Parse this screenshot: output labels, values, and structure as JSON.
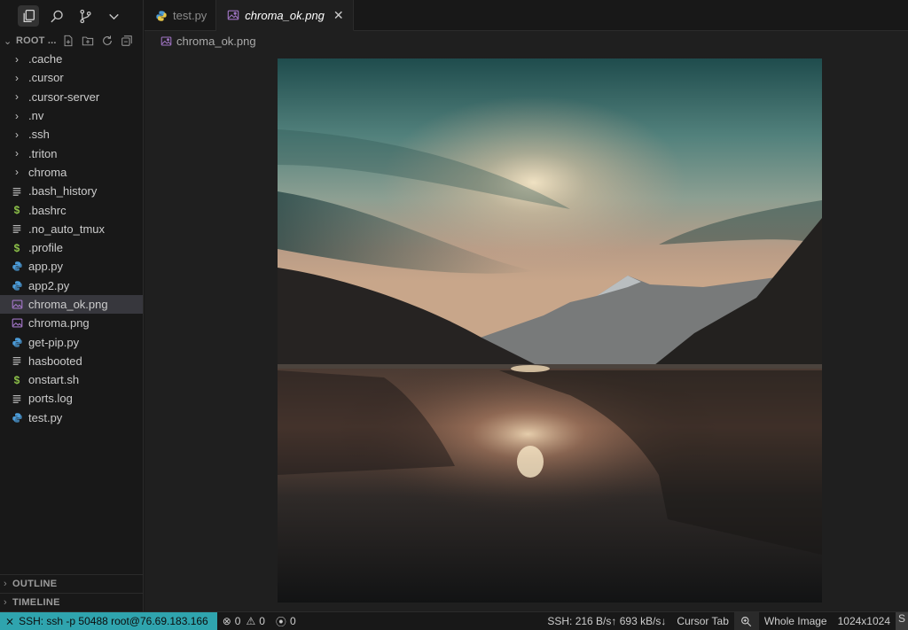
{
  "activity_bar": {
    "items": [
      {
        "name": "explorer-icon",
        "active": true
      },
      {
        "name": "search-icon",
        "active": false
      },
      {
        "name": "source-control-icon",
        "active": false
      },
      {
        "name": "chevron-down-icon",
        "active": false
      }
    ]
  },
  "explorer": {
    "root_label": "ROOT ...",
    "items": [
      {
        "label": ".cache",
        "kind": "folder"
      },
      {
        "label": ".cursor",
        "kind": "folder"
      },
      {
        "label": ".cursor-server",
        "kind": "folder"
      },
      {
        "label": ".nv",
        "kind": "folder"
      },
      {
        "label": ".ssh",
        "kind": "folder"
      },
      {
        "label": ".triton",
        "kind": "folder"
      },
      {
        "label": "chroma",
        "kind": "folder"
      },
      {
        "label": ".bash_history",
        "kind": "text"
      },
      {
        "label": ".bashrc",
        "kind": "shell"
      },
      {
        "label": ".no_auto_tmux",
        "kind": "text"
      },
      {
        "label": ".profile",
        "kind": "shell"
      },
      {
        "label": "app.py",
        "kind": "python"
      },
      {
        "label": "app2.py",
        "kind": "python"
      },
      {
        "label": "chroma_ok.png",
        "kind": "image",
        "selected": true
      },
      {
        "label": "chroma.png",
        "kind": "image"
      },
      {
        "label": "get-pip.py",
        "kind": "python"
      },
      {
        "label": "hasbooted",
        "kind": "text"
      },
      {
        "label": "onstart.sh",
        "kind": "shell"
      },
      {
        "label": "ports.log",
        "kind": "text"
      },
      {
        "label": "test.py",
        "kind": "python"
      }
    ],
    "sections": [
      {
        "label": "OUTLINE"
      },
      {
        "label": "TIMELINE"
      }
    ]
  },
  "tabs": [
    {
      "label": "test.py",
      "kind": "python",
      "active": false
    },
    {
      "label": "chroma_ok.png",
      "kind": "image",
      "active": true,
      "close": "✕"
    }
  ],
  "breadcrumb": {
    "label": "chroma_ok.png"
  },
  "status": {
    "remote": "SSH: ssh -p 50488 root@76.69.183.166",
    "errors": "0",
    "warnings": "0",
    "ports": "0",
    "ssh_speed": "SSH: 216 B/s↑ 693 kB/s↓",
    "cursor_tab": "Cursor Tab",
    "whole_image": "Whole Image",
    "dimensions": "1024x1024",
    "last": "S"
  },
  "colors": {
    "python": "#4b9ad6",
    "shell": "#8dc149",
    "image": "#a074c4",
    "remote_bg": "#2fa4ae"
  }
}
